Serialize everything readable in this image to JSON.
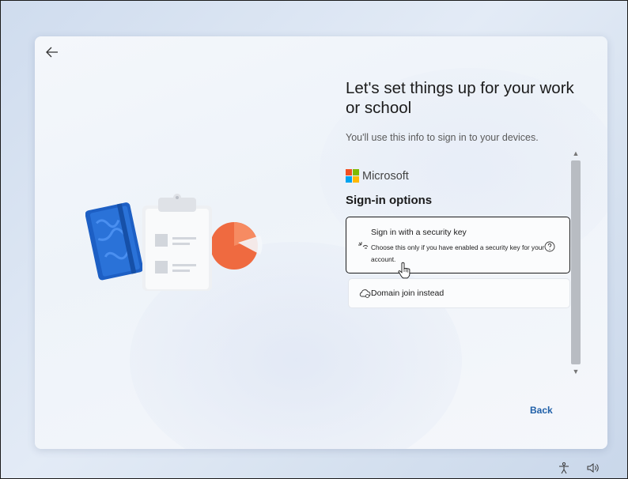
{
  "window": {
    "title": "Let's set things up for your work or school",
    "subtitle": "You'll use this info to sign in to your devices."
  },
  "brand": {
    "name": "Microsoft",
    "colors": [
      "#f25022",
      "#7fba00",
      "#00a4ef",
      "#ffb900"
    ]
  },
  "signin": {
    "section_title": "Sign-in options",
    "options": [
      {
        "title": "Sign in with a security key",
        "description": "Choose this only if you have enabled a security key for your account.",
        "icon": "key-icon",
        "selected": true
      },
      {
        "label": "Domain join instead",
        "icon": "domain-join-icon",
        "selected": false
      }
    ]
  },
  "footer": {
    "back_label": "Back"
  },
  "icons": {
    "back": "arrow-left-icon",
    "help": "help-circle-icon",
    "accessibility": "accessibility-icon",
    "volume": "volume-icon"
  },
  "colors": {
    "accent": "#1f5fa8",
    "illustration_book": "#1d5fc4",
    "illustration_pie": "#ef6a40"
  }
}
